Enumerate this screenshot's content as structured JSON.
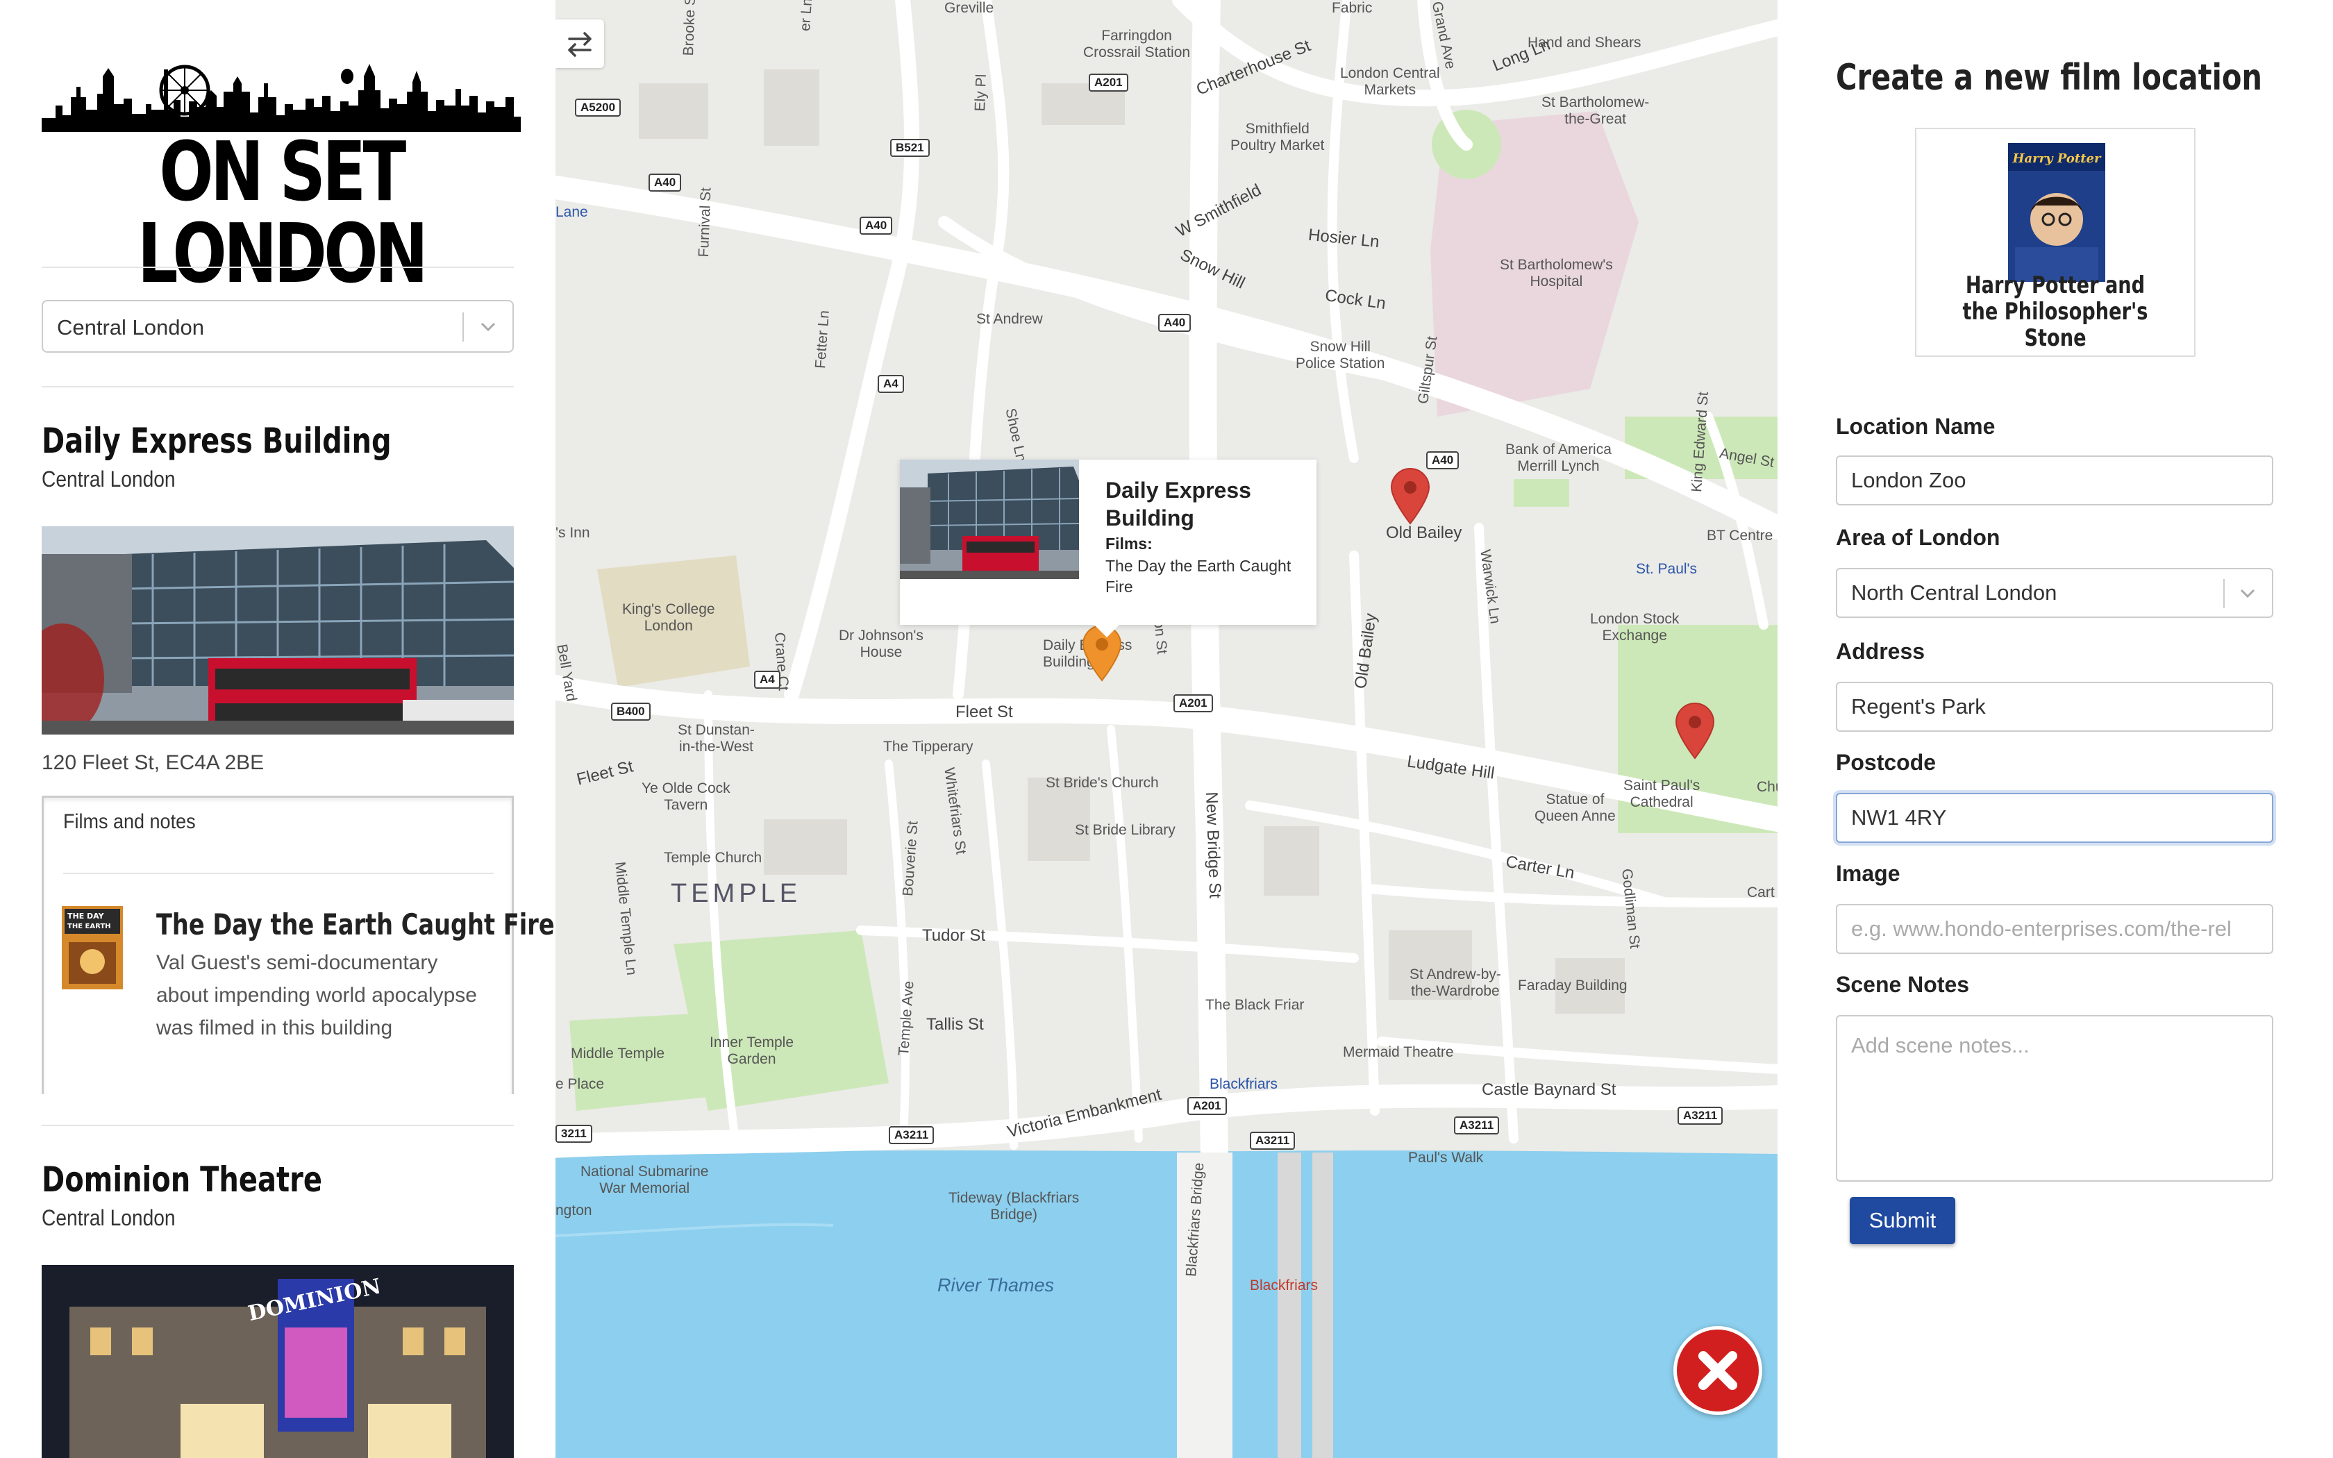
{
  "sidebar": {
    "logo_text": "ON SET LONDON",
    "area_select": {
      "value": "Central London"
    },
    "locations": [
      {
        "name": "Daily Express Building",
        "area": "Central London",
        "address": "120 Fleet St, EC4A 2BE",
        "films_header": "Films and notes",
        "films": [
          {
            "title": "The Day the Earth Caught Fire",
            "notes": "Val Guest's semi-documentary about impending world apocalypse was filmed in this building"
          }
        ]
      },
      {
        "name": "Dominion Theatre",
        "area": "Central London",
        "sign": "DOMINION"
      }
    ]
  },
  "map": {
    "popup": {
      "title": "Daily Express Building",
      "films_label": "Films:",
      "film": "The Day the Earth Caught Fire"
    },
    "labels": {
      "greville": "Greville",
      "fabric": "Fabric",
      "grand_ave": "Grand Ave",
      "farringdon": "Farringdon\nCrossrail Station",
      "charterhouse": "Charterhouse St",
      "london_central_markets": "London Central\nMarkets",
      "long_ln": "Long Ln",
      "hand_and_shears": "Hand and Shears",
      "st_bart_great": "St Bartholomew-\nthe-Great",
      "smithfield_market": "Smithfield\nPoultry Market",
      "w_smithfield": "W Smithfield",
      "hosier_ln": "Hosier Ln",
      "snow_hill": "Snow Hill",
      "cock_ln": "Cock Ln",
      "st_barts_hospital": "St Bartholomew's\nHospital",
      "brooke_st": "Brooke St",
      "ely_pl": "Ely Pl",
      "furnival_st": "Furnival St",
      "st_andrew": "St Andrew",
      "snow_hill_police": "Snow Hill\nPolice Station",
      "giltspur_st": "Giltspur St",
      "king_edward_st": "King Edward St",
      "angel_st": "Angel St",
      "fetter_ln": "Fetter Ln",
      "shoe_ln": "Shoe Ln",
      "old_bailey": "Old Bailey",
      "bank_of_america": "Bank of America\nMerrill Lynch",
      "bt_centre": "BT Centre",
      "st_pauls": "St. Paul's",
      "kings_college": "King's College\nLondon",
      "dr_johnsons": "Dr Johnson's\nHouse",
      "daily_express_short": "Daily Express\nBuilding",
      "old_bailey_street": "Old Bailey",
      "warwick_ln": "Warwick Ln",
      "london_stock_exchange": "London Stock\nExchange",
      "s_inn": "'s Inn",
      "fleet_st": "Fleet St",
      "fleet_st_2": "Fleet St",
      "ludgate_hill": "Ludgate Hill",
      "saint_pauls_cathedral": "Saint Paul's\nCathedral",
      "chu": "Chu",
      "st_dunstan": "St Dunstan-\nin-the-West",
      "the_tipperary": "The Tipperary",
      "st_brides": "St Bride's Church",
      "statue_queen_anne": "Statue of\nQueen Anne",
      "bell_yard": "Bell Yard",
      "ye_olde_cock": "Ye Olde Cock\nTavern",
      "st_bride_library": "St Bride Library",
      "bouverie_st": "Bouverie St",
      "whitefriars_st": "Whitefriars St",
      "new_bridge_st": "New Bridge St",
      "carter_ln": "Carter Ln",
      "godliman_st": "Godliman St",
      "cart": "Cart",
      "temple_church": "Temple Church",
      "temple": "TEMPLE",
      "middle_temple_ln": "Middle Temple Ln",
      "tudor_st": "Tudor St",
      "temple_ave": "Temple Ave",
      "tallis_st": "Tallis St",
      "st_andrew_wardrobe": "St Andrew-by-\nthe-Wardrobe",
      "faraday_building": "Faraday Building",
      "the_black_friar": "The Black Friar",
      "inner_temple_garden": "Inner Temple\nGarden",
      "middle_temple": "Middle Temple",
      "mermaid_theatre": "Mermaid Theatre",
      "e_place": "e Place",
      "blackfriars": "Blackfriars",
      "castle_baynard": "Castle Baynard St",
      "victoria_embankment": "Victoria Embankment",
      "pauls_walk": "Paul's Walk",
      "national_submarine": "National Submarine\nWar Memorial",
      "ngton": "ngton",
      "tideway": "Tideway (Blackfriars\nBridge)",
      "blackfriars_bridge": "Blackfriars Bridge",
      "blackfriars_rail": "Blackfriars",
      "river_thames": "River Thames",
      "lane": "Lane",
      "er_ln": "er Ln",
      "crane_ct": "Crane Ct",
      "on_st": "on St"
    },
    "shields": [
      "A5200",
      "A201",
      "B521",
      "A40",
      "A40",
      "A40",
      "A4",
      "A40",
      "A4",
      "B400",
      "A201",
      "A201",
      "A3211",
      "A3211",
      "A3211",
      "A3211",
      "3211"
    ]
  },
  "form": {
    "title": "Create a new film location",
    "film_card_title": "Harry Potter and the Philosopher's Stone",
    "poster_text": "Harry Potter",
    "location_name": {
      "label": "Location Name",
      "value": "London Zoo"
    },
    "area": {
      "label": "Area of London",
      "value": "North Central London"
    },
    "address": {
      "label": "Address",
      "value": "Regent's Park"
    },
    "postcode": {
      "label": "Postcode",
      "value": "NW1 4RY"
    },
    "image": {
      "label": "Image",
      "placeholder": "e.g. www.hondo-enterprises.com/the-rel"
    },
    "notes": {
      "label": "Scene Notes",
      "placeholder": "Add scene notes..."
    },
    "submit_label": "Submit"
  },
  "colors": {
    "accent": "#1f4aa0",
    "pin": "#d9453a",
    "pin_selected": "#f0922b",
    "water": "#8ccfee",
    "park": "#cce8b5",
    "close": "#d11f1f"
  },
  "icons": {
    "toggle": "swap-arrows-icon",
    "close": "close-x-icon",
    "chevron": "chevron-down-icon",
    "pin": "map-pin-icon"
  }
}
